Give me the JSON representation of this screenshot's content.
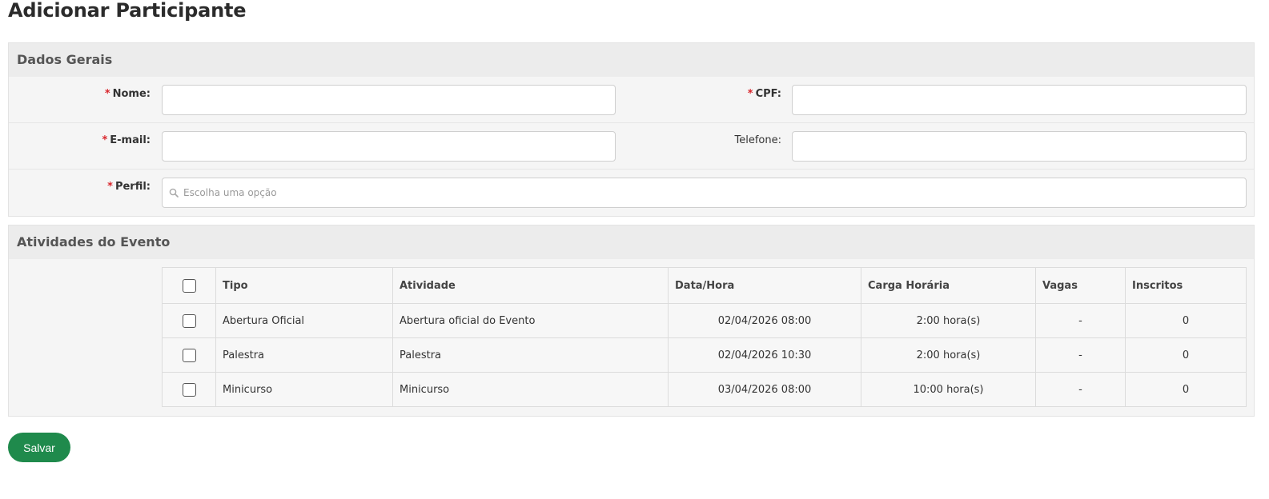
{
  "page": {
    "title": "Adicionar Participante"
  },
  "dados_gerais": {
    "header": "Dados Gerais",
    "required_mark": "*",
    "nome": {
      "label": "Nome:",
      "value": ""
    },
    "cpf": {
      "label": "CPF:",
      "value": ""
    },
    "email": {
      "label": "E-mail:",
      "value": ""
    },
    "telefone": {
      "label": "Telefone:",
      "value": ""
    },
    "perfil": {
      "label": "Perfil:",
      "placeholder": "Escolha uma opção",
      "icon": "search-icon"
    }
  },
  "atividades": {
    "header": "Atividades do Evento",
    "columns": [
      "Tipo",
      "Atividade",
      "Data/Hora",
      "Carga Horária",
      "Vagas",
      "Inscritos"
    ],
    "rows": [
      {
        "tipo": "Abertura Oficial",
        "atividade": "Abertura oficial do Evento",
        "data_hora": "02/04/2026 08:00",
        "carga": "2:00 hora(s)",
        "vagas": "-",
        "inscritos": "0",
        "checked": false
      },
      {
        "tipo": "Palestra",
        "atividade": "Palestra",
        "data_hora": "02/04/2026 10:30",
        "carga": "2:00 hora(s)",
        "vagas": "-",
        "inscritos": "0",
        "checked": false
      },
      {
        "tipo": "Minicurso",
        "atividade": "Minicurso",
        "data_hora": "03/04/2026 08:00",
        "carga": "10:00 hora(s)",
        "vagas": "-",
        "inscritos": "0",
        "checked": false
      }
    ]
  },
  "actions": {
    "save_label": "Salvar"
  },
  "colors": {
    "accent": "#1f8a4c",
    "required": "#d9252b"
  }
}
